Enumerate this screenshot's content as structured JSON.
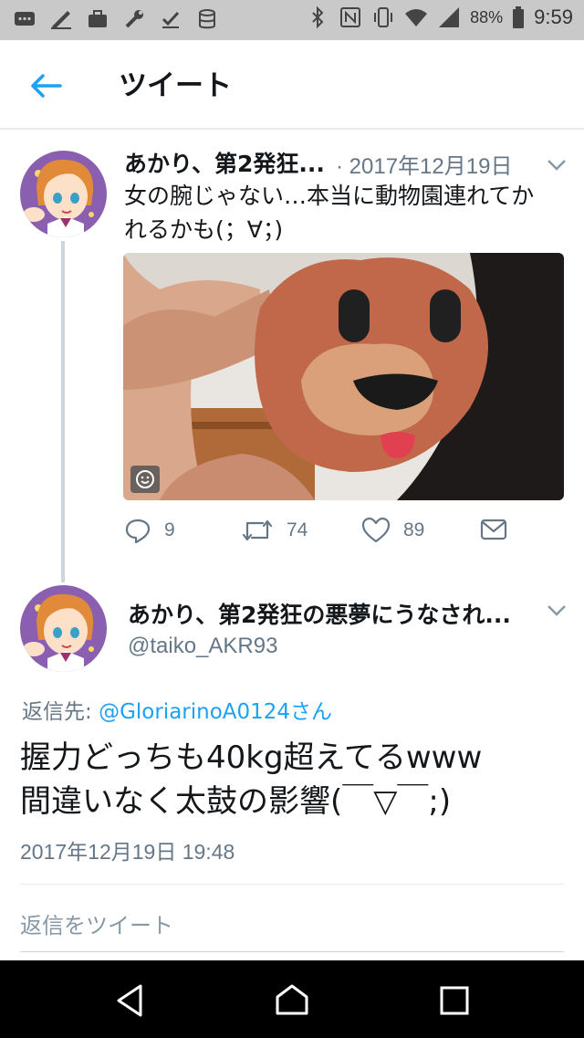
{
  "status_bar": {
    "battery": "88%",
    "time": "9:59"
  },
  "app_bar": {
    "title": "ツイート",
    "back_icon": "arrow-left-icon"
  },
  "colors": {
    "accent": "#1da1f2",
    "secondary_text": "#657786",
    "thread_line": "#ccd6dd"
  },
  "tweet_parent": {
    "name": "あかり、第2発狂...",
    "date": "· 2017年12月19日",
    "text_lines": [
      "女の腕じゃない…本当に動物園連れてか",
      "れるかも(；∀；)"
    ],
    "actions": {
      "replies": "9",
      "retweets": "74",
      "likes": "89"
    }
  },
  "tweet_main": {
    "name": "あかり、第2発狂の悪夢にうなされ...",
    "handle": "@taiko_AKR93",
    "reply_prefix": "返信先: ",
    "reply_mention": "@GloriarinoA0124さん",
    "text_lines": [
      "握力どっちも40kg超えてるwww",
      "間違いなく太鼓の影響(￣▽￣;)"
    ],
    "timestamp": "2017年12月19日 19:48"
  },
  "reply_input": {
    "placeholder": "返信をツイート"
  }
}
